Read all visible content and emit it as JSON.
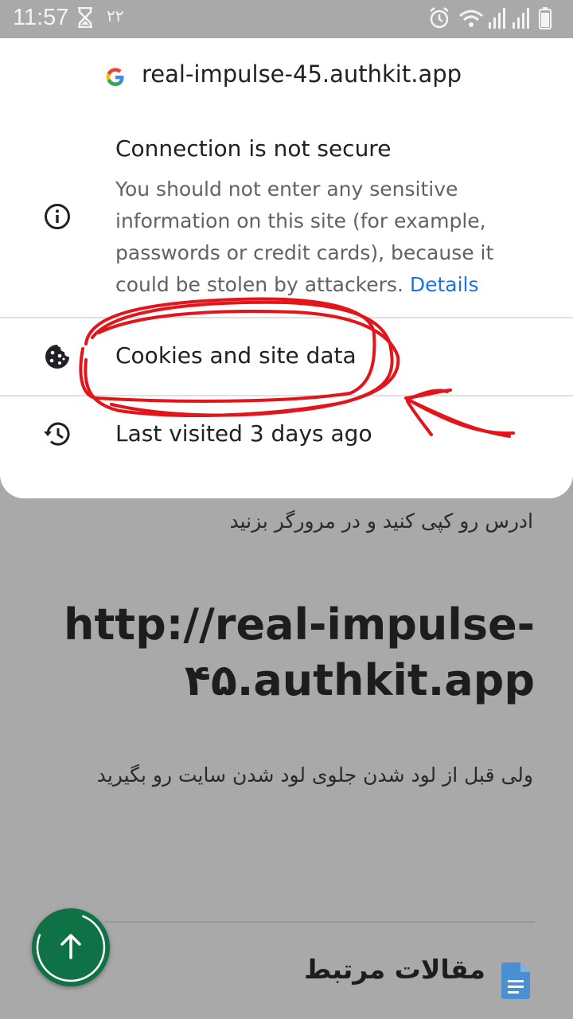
{
  "status_bar": {
    "time": "11:57",
    "digits": "۲۲"
  },
  "site_info": {
    "domain": "real-impulse-45.authkit.app",
    "security": {
      "title": "Connection is not secure",
      "description": "You should not enter any sensitive information on this site (for example, passwords or credit cards), because it could be stolen by attackers.",
      "details_link": "Details"
    },
    "cookies_label": "Cookies and site data",
    "last_visited_label": "Last visited 3 days ago"
  },
  "page": {
    "instruction_1": "ادرس رو کپی کنید و در مرورگر بزنید",
    "url_line_1": "http://real-impulse-",
    "url_line_2": "۴۵.authkit.app",
    "instruction_2": "ولی قبل از لود شدن جلوی لود شدن سایت رو بگیرید",
    "related_title": "مقالات مرتبط"
  },
  "colors": {
    "scrim": "#a9a9a9",
    "link": "#1a73e8",
    "fab": "#0f7246",
    "annotation": "#e4141b"
  }
}
